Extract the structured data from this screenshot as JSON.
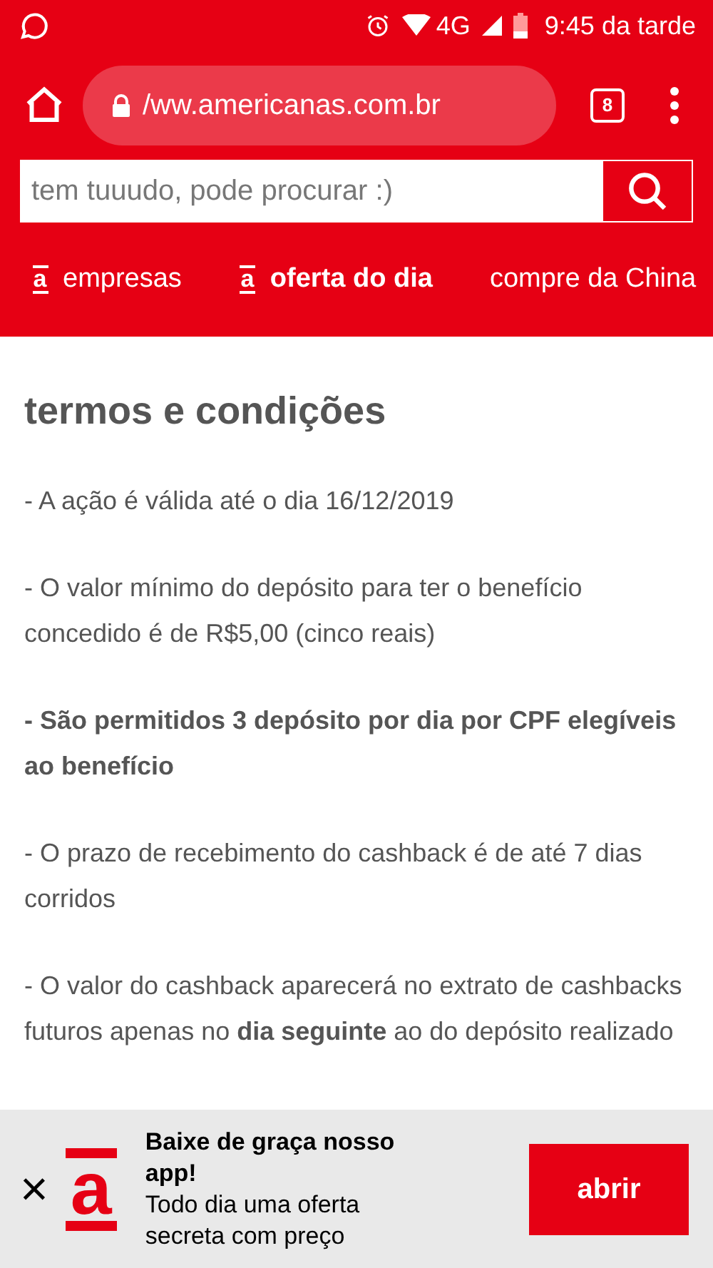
{
  "status_bar": {
    "time": "9:45 da tarde",
    "network": "4G"
  },
  "browser": {
    "url": "/ww.americanas.com.br",
    "tab_count": "8"
  },
  "search": {
    "placeholder": "tem tuuudo, pode procurar :)"
  },
  "nav": [
    {
      "label": "empresas",
      "logo": "a",
      "bold": false
    },
    {
      "label": "oferta do dia",
      "logo": "a",
      "bold": true
    },
    {
      "label": "compre da China",
      "bold": false
    }
  ],
  "content": {
    "title": "termos e condições",
    "paragraphs": [
      "- A ação é válida até o dia 16/12/2019",
      "- O valor mínimo do depósito para ter o benefício concedido é de R$5,00 (cinco reais)",
      "**- São permitidos 3 depósito por dia por CPF elegíveis ao benefício**",
      "- O prazo de recebimento do cashback é de até 7 dias corridos",
      "- O valor do cashback aparecerá no extrato de cashbacks futuros apenas no **dia seguinte** ao do depósito realizado"
    ]
  },
  "app_banner": {
    "close": "×",
    "logo": "a",
    "title": "Baixe de graça nosso app!",
    "text": "Todo dia uma oferta secreta com preço",
    "button": "abrir"
  }
}
